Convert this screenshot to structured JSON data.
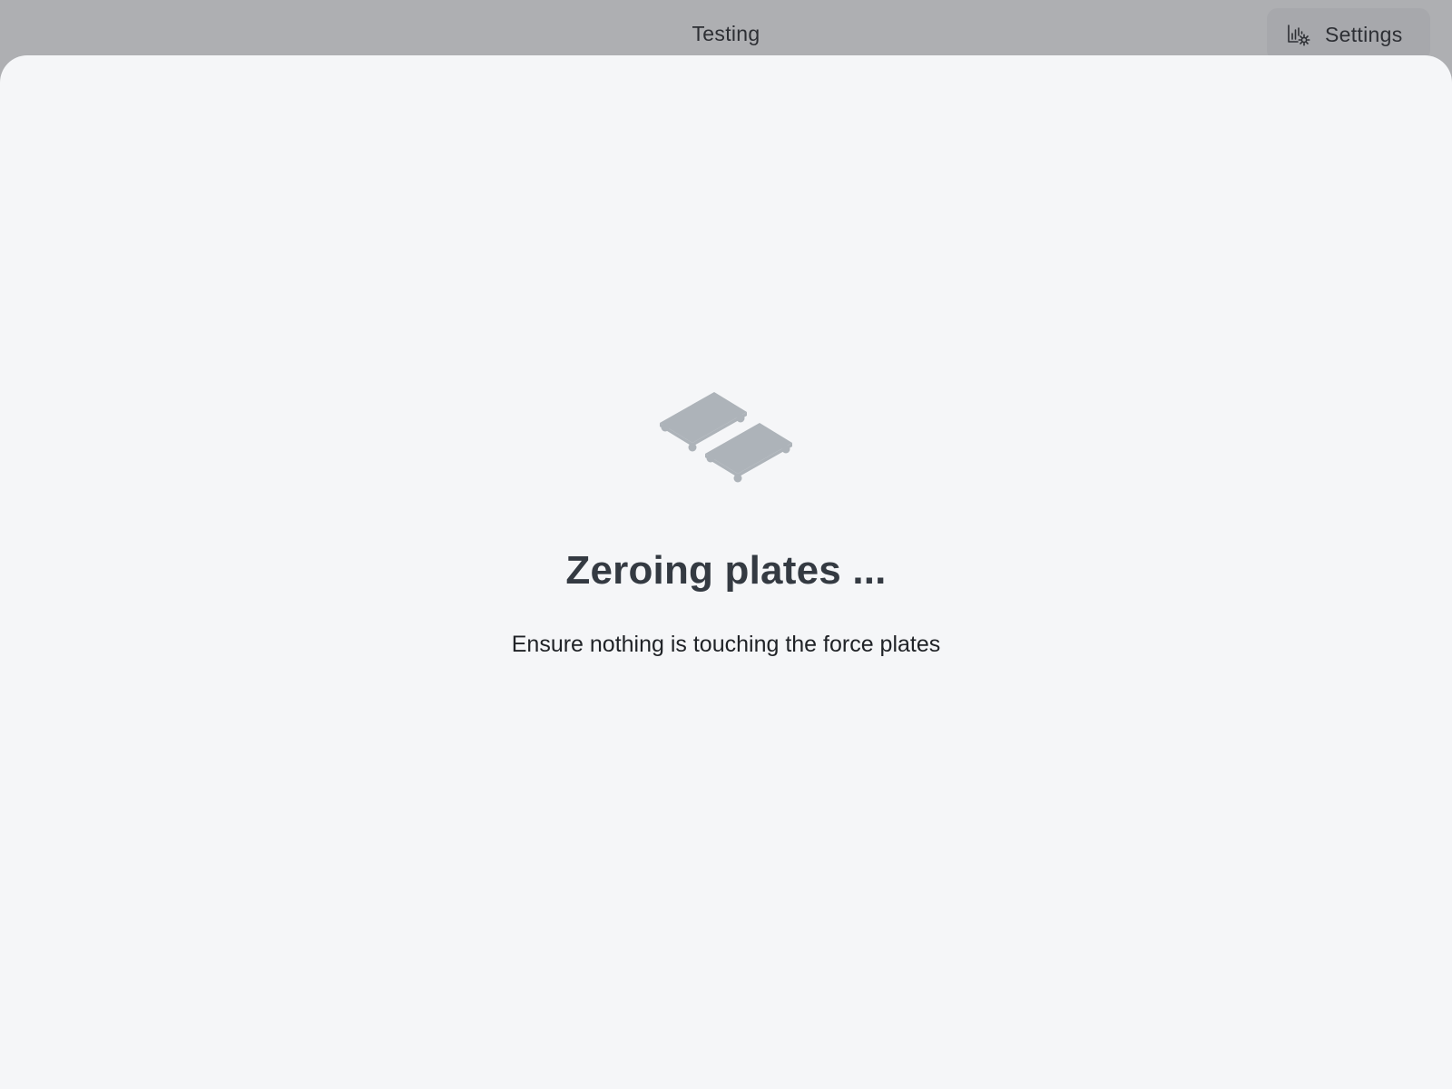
{
  "header": {
    "title": "Testing",
    "settings_label": "Settings",
    "settings_icon": "chart-gear-icon"
  },
  "main": {
    "illustration_icon": "force-plates-icon",
    "headline": "Zeroing plates ...",
    "instruction": "Ensure nothing is touching the force plates"
  },
  "colors": {
    "backdrop": "#aeafb2",
    "sheet_background": "#f5f6f8",
    "illustration": "#adb3b9",
    "headline_text": "#343a42",
    "body_text": "#202327"
  }
}
